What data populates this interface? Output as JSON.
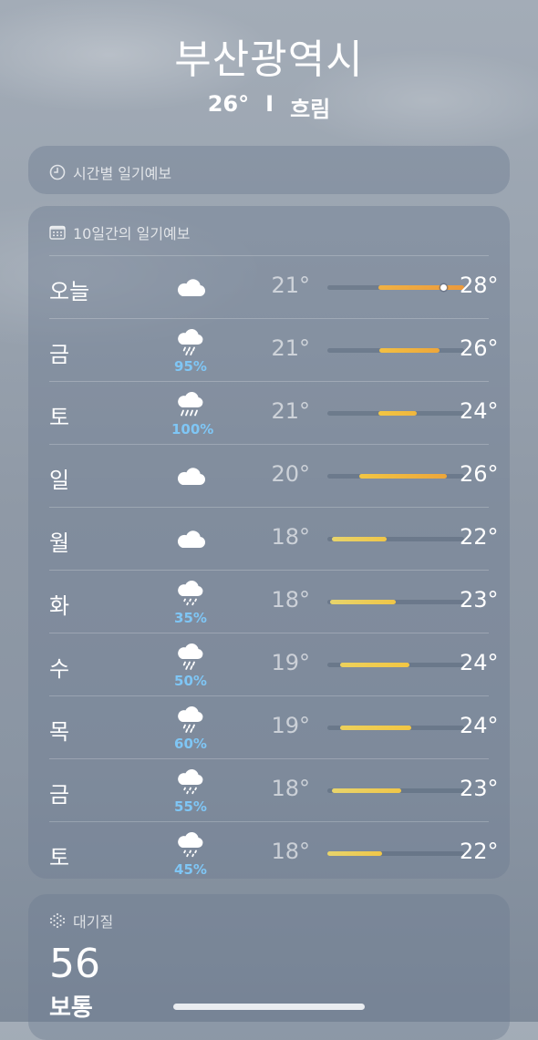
{
  "header": {
    "city": "부산광역시",
    "temp": "26°",
    "separator": "I",
    "condition": "흐림"
  },
  "hourly": {
    "title": "시간별 일기예보",
    "icon": "clock-icon"
  },
  "ten_day": {
    "title": "10일간의 일기예보",
    "icon": "calendar-icon",
    "days": [
      {
        "day": "오늘",
        "icon": "cloud-icon",
        "precip": "",
        "low": "21°",
        "high": "28°",
        "range_start": 0.37,
        "range_end": 1.0,
        "colors": [
          "#f0b143",
          "#ec9a3c"
        ],
        "current": 0.85
      },
      {
        "day": "금",
        "icon": "cloud-rain-icon",
        "precip": "95%",
        "low": "21°",
        "high": "26°",
        "range_start": 0.38,
        "range_end": 0.82,
        "colors": [
          "#f2c043",
          "#eda63a"
        ]
      },
      {
        "day": "토",
        "icon": "cloud-heavy-rain-icon",
        "precip": "100%",
        "low": "21°",
        "high": "24°",
        "range_start": 0.37,
        "range_end": 0.65,
        "colors": [
          "#f2c643",
          "#f0b63d"
        ]
      },
      {
        "day": "일",
        "icon": "cloud-icon",
        "precip": "",
        "low": "20°",
        "high": "26°",
        "range_start": 0.23,
        "range_end": 0.87,
        "colors": [
          "#f2c643",
          "#eda63a"
        ]
      },
      {
        "day": "월",
        "icon": "cloud-icon",
        "precip": "",
        "low": "18°",
        "high": "22°",
        "range_start": 0.03,
        "range_end": 0.43,
        "colors": [
          "#e7d46c",
          "#f0c648"
        ]
      },
      {
        "day": "화",
        "icon": "cloud-drizzle-icon",
        "precip": "35%",
        "low": "18°",
        "high": "23°",
        "range_start": 0.02,
        "range_end": 0.5,
        "colors": [
          "#e7d46c",
          "#f0c648"
        ]
      },
      {
        "day": "수",
        "icon": "cloud-rain-icon",
        "precip": "50%",
        "low": "19°",
        "high": "24°",
        "range_start": 0.09,
        "range_end": 0.6,
        "colors": [
          "#edd15c",
          "#f2c643"
        ]
      },
      {
        "day": "목",
        "icon": "cloud-rain-icon",
        "precip": "60%",
        "low": "19°",
        "high": "24°",
        "range_start": 0.09,
        "range_end": 0.61,
        "colors": [
          "#edd15c",
          "#f2c643"
        ]
      },
      {
        "day": "금",
        "icon": "cloud-drizzle-icon",
        "precip": "55%",
        "low": "18°",
        "high": "23°",
        "range_start": 0.03,
        "range_end": 0.54,
        "colors": [
          "#e7d46c",
          "#f0c648"
        ]
      },
      {
        "day": "토",
        "icon": "cloud-drizzle-icon",
        "precip": "45%",
        "low": "18°",
        "high": "22°",
        "range_start": 0.0,
        "range_end": 0.4,
        "colors": [
          "#e7d46c",
          "#f0c648"
        ]
      }
    ]
  },
  "air_quality": {
    "title": "대기질",
    "icon": "air-quality-icon",
    "value": "56",
    "label": "보통"
  }
}
